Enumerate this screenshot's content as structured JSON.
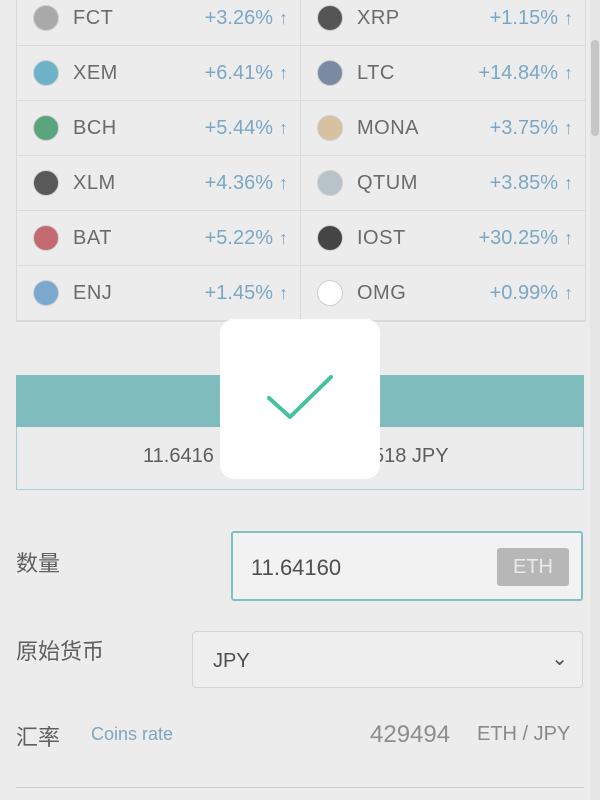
{
  "coins": [
    {
      "name": "FCT",
      "change": "+3.26%",
      "icon": "fct-icon",
      "color": "#a9a9a9"
    },
    {
      "name": "XRP",
      "change": "+1.15%",
      "icon": "xrp-icon",
      "color": "#555555"
    },
    {
      "name": "XEM",
      "change": "+6.41%",
      "icon": "xem-icon",
      "color": "#6db3c7"
    },
    {
      "name": "LTC",
      "change": "+14.84%",
      "icon": "ltc-icon",
      "color": "#7a8aa3"
    },
    {
      "name": "BCH",
      "change": "+5.44%",
      "icon": "bch-icon",
      "color": "#5aa47e"
    },
    {
      "name": "MONA",
      "change": "+3.75%",
      "icon": "mona-icon",
      "color": "#d6c2a0"
    },
    {
      "name": "XLM",
      "change": "+4.36%",
      "icon": "xlm-icon",
      "color": "#595959"
    },
    {
      "name": "QTUM",
      "change": "+3.85%",
      "icon": "qtum-icon",
      "color": "#b7c3c8"
    },
    {
      "name": "BAT",
      "change": "+5.22%",
      "icon": "bat-icon",
      "color": "#c26a6f"
    },
    {
      "name": "IOST",
      "change": "+30.25%",
      "icon": "iost-icon",
      "color": "#454545"
    },
    {
      "name": "ENJ",
      "change": "+1.45%",
      "icon": "enj-icon",
      "color": "#7aa8cf"
    },
    {
      "name": "OMG",
      "change": "+0.99%",
      "icon": "omg-icon",
      "color": "#ffffff"
    }
  ],
  "conversion": {
    "left_text": "11.6416",
    "right_text": "518 JPY"
  },
  "quantity": {
    "label": "数量",
    "value": "11.64160",
    "unit": "ETH"
  },
  "source_currency": {
    "label": "原始货币",
    "selected": "JPY"
  },
  "rate": {
    "label": "汇率",
    "link": "Coins rate",
    "value": "429494",
    "unit": "ETH / JPY"
  },
  "colors": {
    "accent": "#7fbcbd",
    "change": "#7aa7c6"
  }
}
